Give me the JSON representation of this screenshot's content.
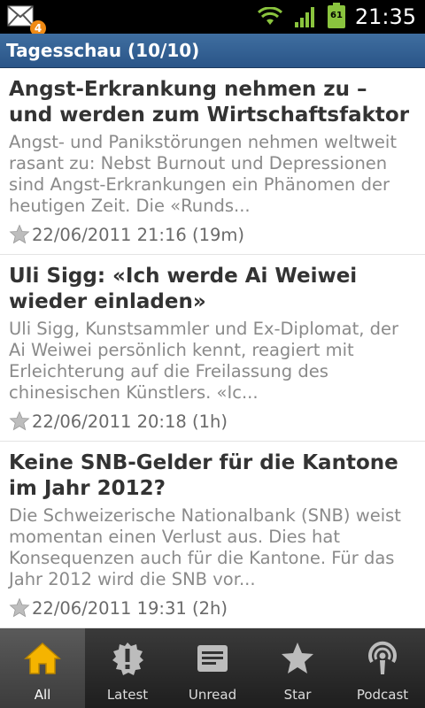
{
  "statusbar": {
    "notification_count": "4",
    "battery": "61",
    "time": "21:35"
  },
  "titlebar": {
    "title": "Tagesschau (10/10)"
  },
  "articles": [
    {
      "title": "Angst-Erkrankung nehmen zu – und werden zum Wirtschaftsfaktor",
      "description": "Angst- und Panikstörungen nehmen weltweit rasant zu: Nebst Burnout und Depressionen sind Angst-Erkrankungen ein Phänomen der heutigen Zeit. Die «Runds...",
      "meta": "22/06/2011 21:16 (19m)"
    },
    {
      "title": "Uli Sigg: «Ich werde Ai Weiwei wieder einladen»",
      "description": "Uli Sigg, Kunstsammler und Ex-Diplomat, der Ai Weiwei persönlich kennt, reagiert mit Erleichterung auf die Freilassung des chinesischen Künstlers. «Ic...",
      "meta": "22/06/2011 20:18 (1h)"
    },
    {
      "title": "Keine SNB-Gelder für die Kantone im Jahr 2012?",
      "description": "Die Schweizerische Nationalbank (SNB) weist momentan einen Verlust aus. Dies hat Konsequenzen auch für die Kantone. Für das Jahr 2012 wird die SNB vor...",
      "meta": "22/06/2011 19:31 (2h)"
    }
  ],
  "tabs": [
    {
      "label": "All",
      "icon": "home-icon"
    },
    {
      "label": "Latest",
      "icon": "exclamation-icon"
    },
    {
      "label": "Unread",
      "icon": "document-icon"
    },
    {
      "label": "Star",
      "icon": "star-icon"
    },
    {
      "label": "Podcast",
      "icon": "podcast-icon"
    }
  ],
  "colors": {
    "titlebar": "#2f5d8f",
    "active_tab_icon": "#f5b400",
    "title_text": "#333333",
    "desc_text": "#8a8a8a"
  }
}
